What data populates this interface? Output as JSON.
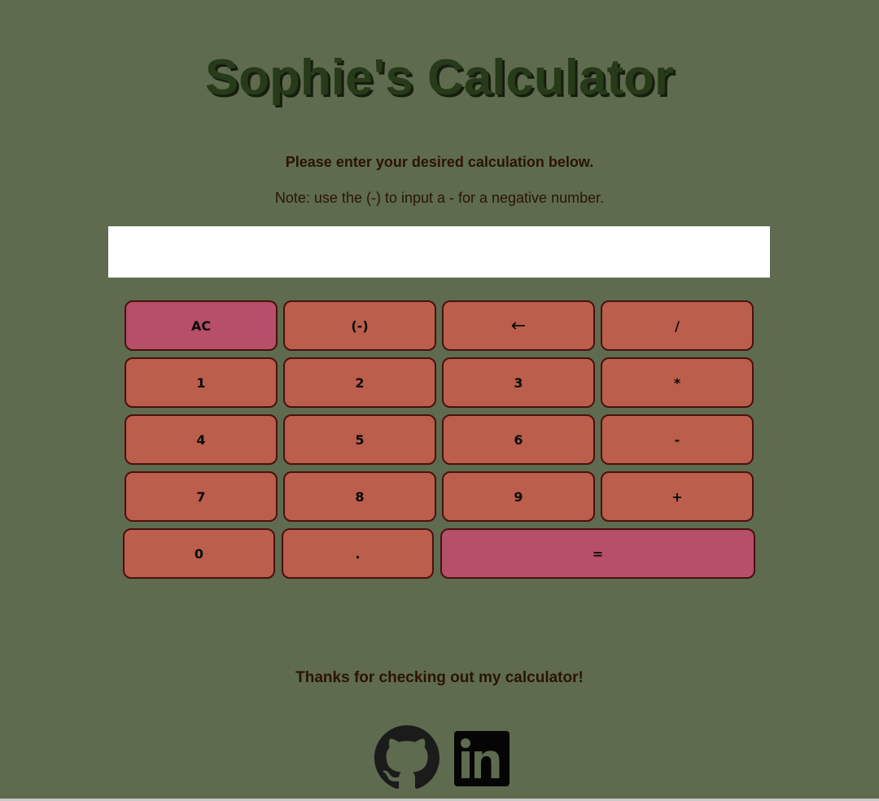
{
  "header": {
    "title": "Sophie's Calculator",
    "instructions": "Please enter your desired calculation below.",
    "note": "Note: use the (-) to input a - for a negative number."
  },
  "display": {
    "value": ""
  },
  "keys": {
    "ac": "AC",
    "negate": "(-)",
    "backspace": "←",
    "divide": "/",
    "one": "1",
    "two": "2",
    "three": "3",
    "multiply": "*",
    "four": "4",
    "five": "5",
    "six": "6",
    "subtract": "-",
    "seven": "7",
    "eight": "8",
    "nine": "9",
    "add": "+",
    "zero": "0",
    "decimal": ".",
    "equals": "="
  },
  "footer": {
    "thanks": "Thanks for checking out my calculator!",
    "icons": [
      "github-icon",
      "linkedin-icon"
    ]
  },
  "colors": {
    "background": "#5e6b4f",
    "title": "#273a19",
    "key": "#bb5e4b",
    "key_accent": "#b64f68",
    "key_border": "#4a1010",
    "text": "#2b1400"
  }
}
